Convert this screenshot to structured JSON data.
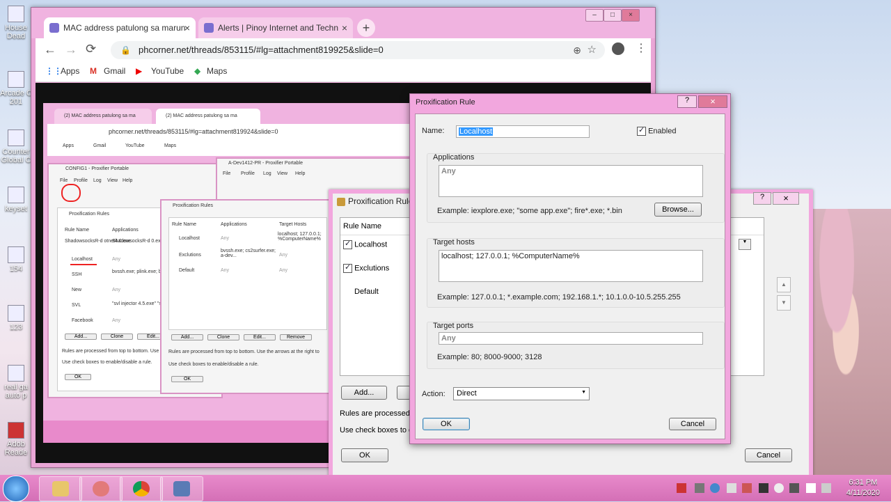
{
  "desktop": {
    "icons": [
      {
        "label": "House Dead"
      },
      {
        "label": "Arcade C 201"
      },
      {
        "label": "Counter Global C"
      },
      {
        "label": "keyset"
      },
      {
        "label": "154"
      },
      {
        "label": "123"
      },
      {
        "label": "real ga auto p"
      },
      {
        "label": "Adob Reade"
      }
    ]
  },
  "browser": {
    "tabs": [
      {
        "title": "MAC address patulong sa marun",
        "close": "×"
      },
      {
        "title": "Alerts | Pinoy Internet and Techn",
        "close": "×"
      }
    ],
    "new_tab": "+",
    "url": "phcorner.net/threads/853115/#lg=attachment819925&slide=0",
    "nav": {
      "back": "←",
      "forward": "→",
      "reload": "⟳"
    },
    "bookmarks": [
      "Apps",
      "Gmail",
      "YouTube",
      "Maps"
    ],
    "window_controls": {
      "minimize": "–",
      "maximize": "□",
      "close": "×"
    }
  },
  "embedded": {
    "tabs": [
      "(2) MAC address patulong sa ma",
      "(2) MAC address patulong sa ma"
    ],
    "url": "phcorner.net/threads/853115/#lg=attachment819924&slide=0",
    "bookmarks": [
      "Apps",
      "Gmail",
      "YouTube",
      "Maps"
    ],
    "config_title": "CONFIG1 - Proxifier Portable",
    "menu": [
      "File",
      "Profile",
      "Log",
      "View",
      "Help"
    ],
    "dev_title": "A-Dev1412-PR - Proxifier Portable",
    "dev_menu": [
      "File",
      "Profile",
      "Log",
      "View",
      "Help"
    ],
    "rules_small_title": "Proxification Rules",
    "rules_small_headers": [
      "Rule Name",
      "Applications"
    ],
    "rules_small_rows": [
      {
        "name": "ShadowsocksR-d otnet4.0.exe",
        "app": "ShadowsocksR-d 0.exe"
      },
      {
        "name": "Localhost",
        "app": "Any"
      },
      {
        "name": "SSH",
        "app": "bvssh.exe; plink.exe; bvsvl.exe; svlc.exe"
      },
      {
        "name": "New",
        "app": "Any"
      },
      {
        "name": "SVL",
        "app": "\"svl injector 4.5.exe\" \"svl injector 4.4.exe\""
      },
      {
        "name": "Facebook",
        "app": "Any"
      }
    ],
    "rules_small_buttons": [
      "Add...",
      "Clone",
      "Edit..."
    ],
    "rules_small_note1": "Rules are processed from top to bottom. Use th",
    "rules_small_note2": "Use check boxes to enable/disable a rule.",
    "rules_small_ok": "OK",
    "rules_mid_title": "Proxification Rules",
    "rules_mid_headers": [
      "Rule Name",
      "Applications",
      "Target Hosts"
    ],
    "rules_mid_rows": [
      {
        "name": "Localhost",
        "app": "Any",
        "hosts": "localhost; 127.0.0.1; %ComputerName%"
      },
      {
        "name": "Exclutions",
        "app": "bvssh.exe; cs2surfer.exe; a-dev...",
        "hosts": "Any"
      },
      {
        "name": "Default",
        "app": "Any",
        "hosts": "Any"
      }
    ],
    "rules_mid_buttons": [
      "Add...",
      "Clone",
      "Edit...",
      "Remove"
    ],
    "rules_mid_note1": "Rules are processed from top to bottom. Use the arrows at the right to",
    "rules_mid_note2": "Use check boxes to enable/disable a rule.",
    "rules_mid_ok": "OK"
  },
  "rules_window": {
    "title": "Proxification Rules",
    "help": "?",
    "close": "×",
    "column": "Rule Name",
    "rows": [
      {
        "name": "Localhost",
        "checked": true
      },
      {
        "name": "Exclutions",
        "checked": true
      },
      {
        "name": "Default",
        "checked": false
      }
    ],
    "add": "Add...",
    "note1": "Rules are processed fr",
    "note2": "Use check boxes to en",
    "ok": "OK",
    "cancel": "Cancel"
  },
  "dialog": {
    "title": "Proxification Rule",
    "help": "?",
    "close": "×",
    "name_label": "Name:",
    "name_value": "Localhost",
    "enabled_label": "Enabled",
    "applications": {
      "label": "Applications",
      "value": "Any",
      "example": "Example: iexplore.exe; \"some app.exe\"; fire*.exe; *.bin",
      "browse": "Browse..."
    },
    "target_hosts": {
      "label": "Target hosts",
      "value": "localhost; 127.0.0.1; %ComputerName%",
      "example": "Example: 127.0.0.1; *.example.com; 192.168.1.*; 10.1.0.0-10.5.255.255"
    },
    "target_ports": {
      "label": "Target ports",
      "value": "Any",
      "example": "Example: 80; 8000-9000; 3128"
    },
    "action_label": "Action:",
    "action_value": "Direct",
    "ok": "OK",
    "cancel": "Cancel"
  },
  "taskbar": {
    "time": "6:31 PM",
    "date": "4/11/2020"
  },
  "colors": {
    "accent": "#f2a7de",
    "taskbar": "#e88acb"
  }
}
